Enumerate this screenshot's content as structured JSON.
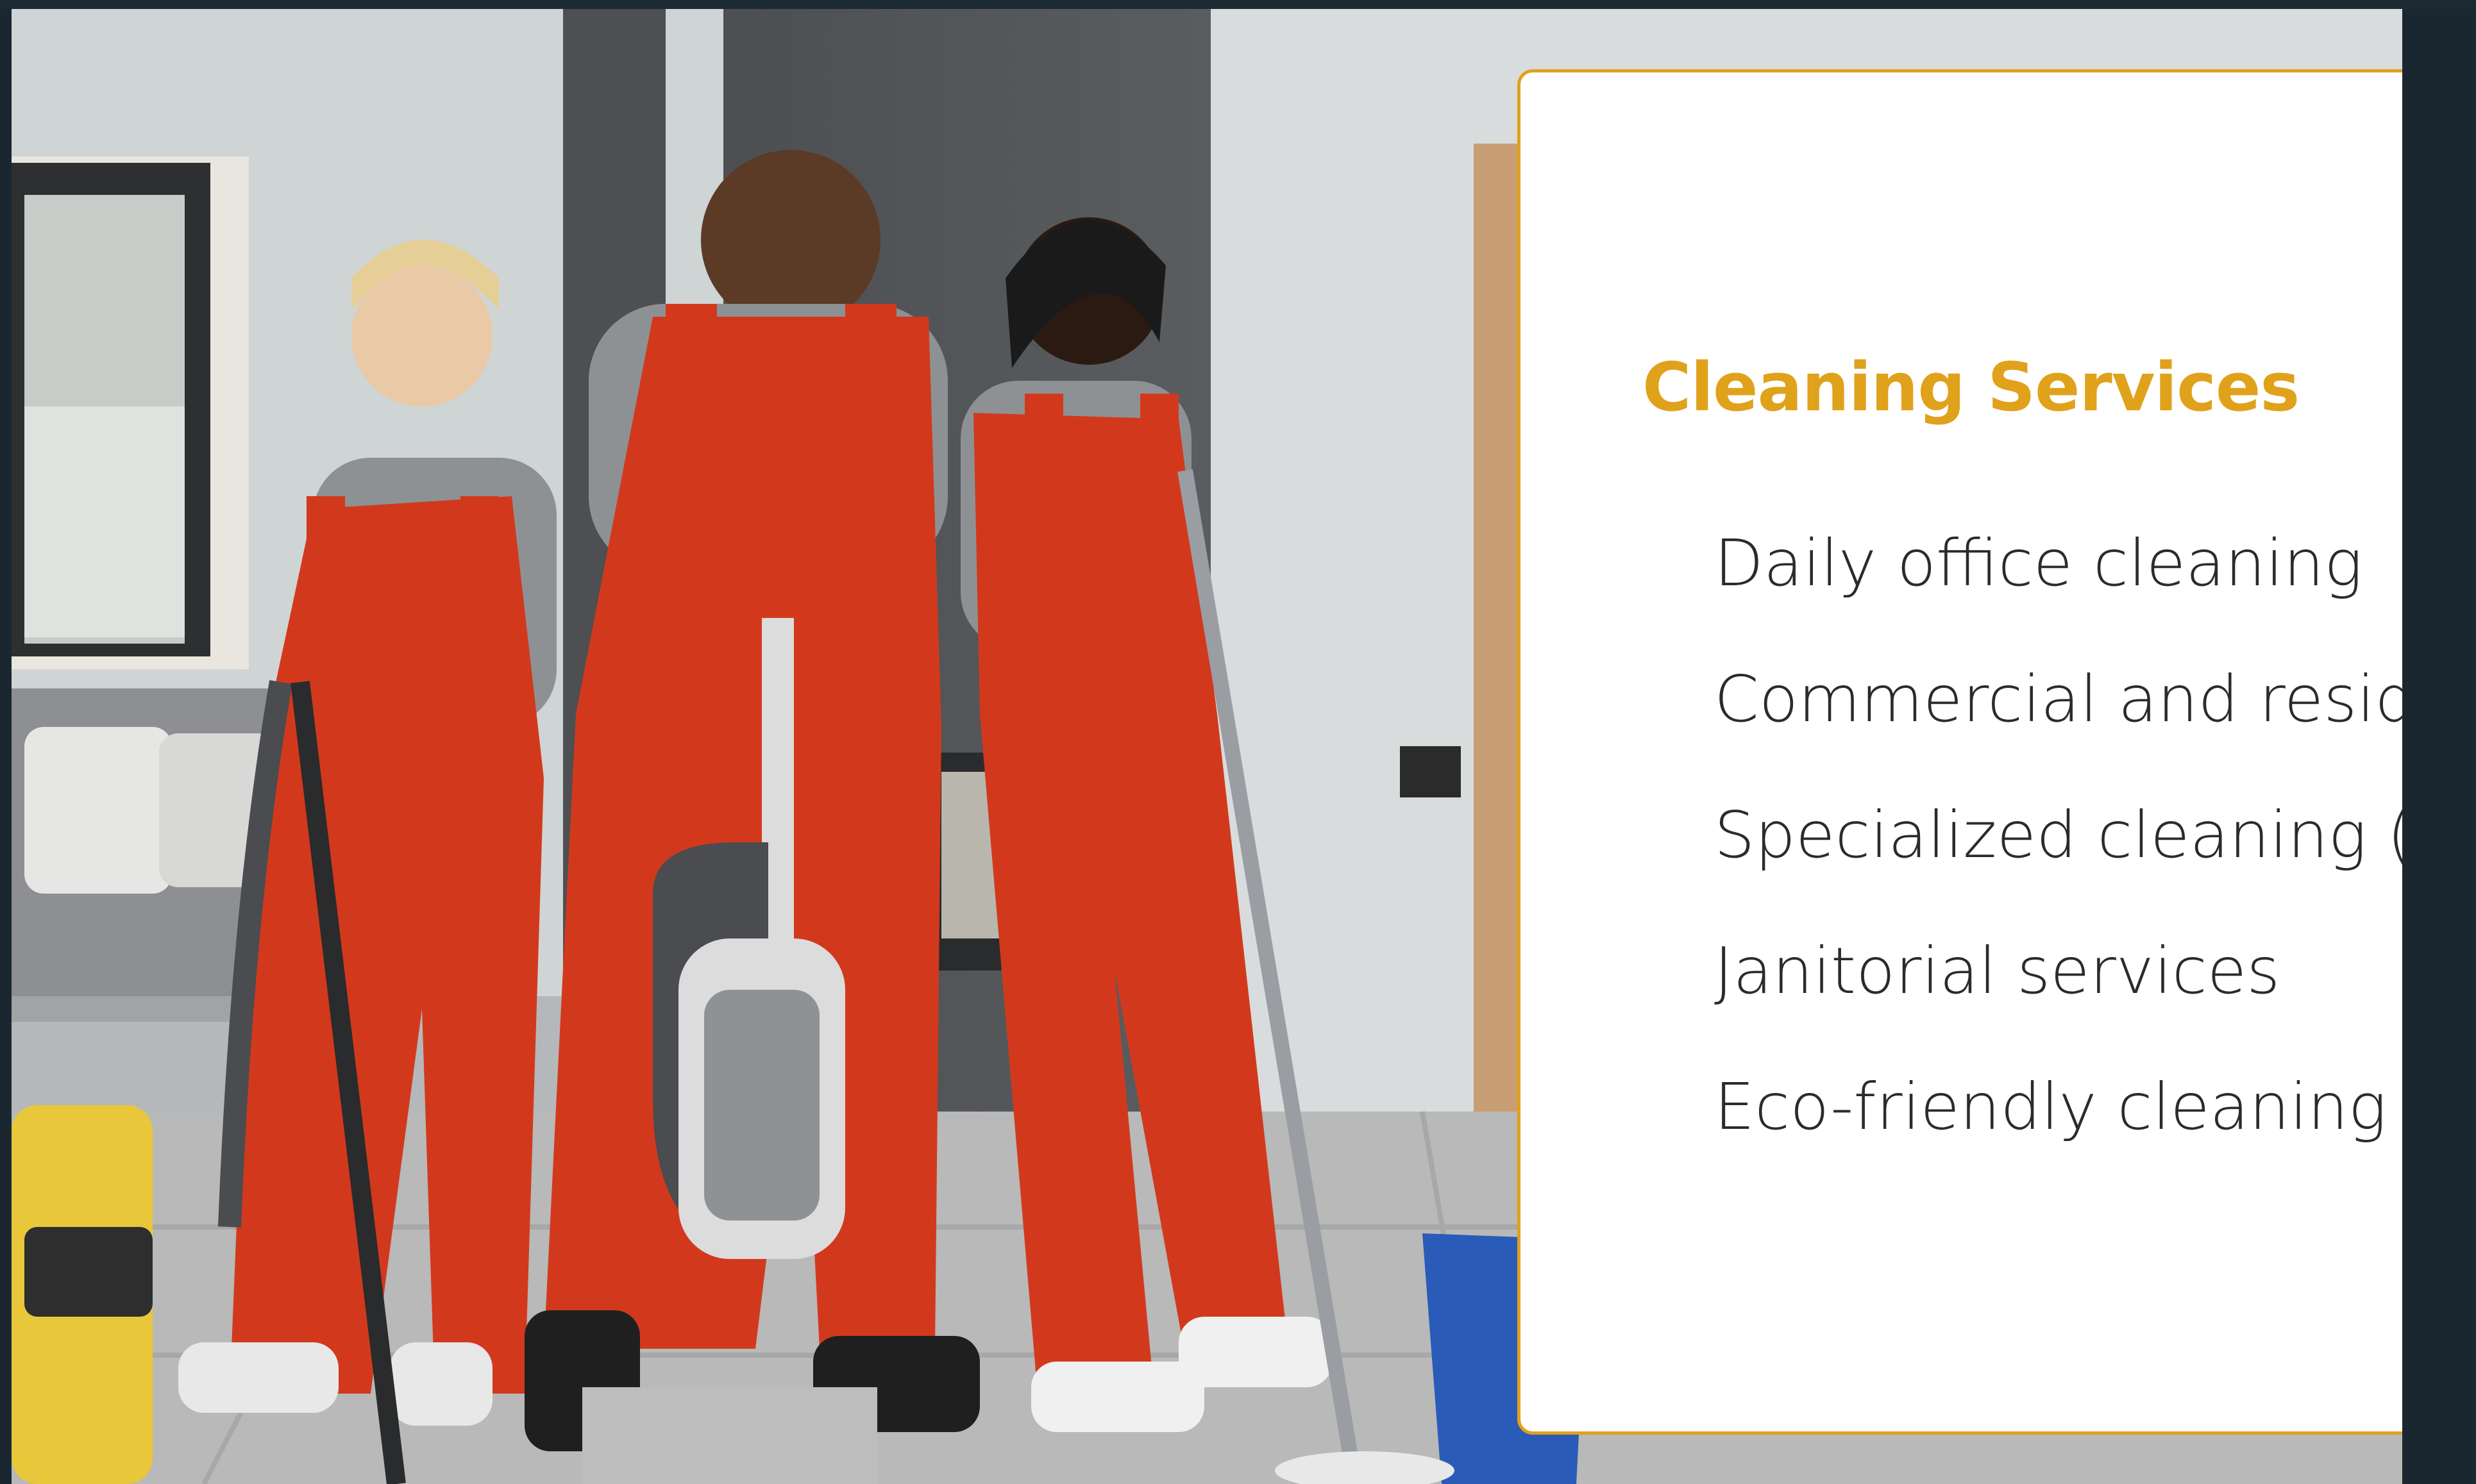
{
  "slide": {
    "image": {
      "alt_icon": "cleaning-crew-photo"
    },
    "card": {
      "title": "Cleaning Services",
      "services": [
        "Daily office cleaning",
        "Commercial and reside",
        "Specialized cleaning (p",
        "Janitorial services",
        "Eco-friendly cleaning s"
      ]
    }
  },
  "colors": {
    "accent": "#e0a11b",
    "text": "#2b2b2b",
    "frame": "#1b2730",
    "overalls": "#d2391c"
  }
}
